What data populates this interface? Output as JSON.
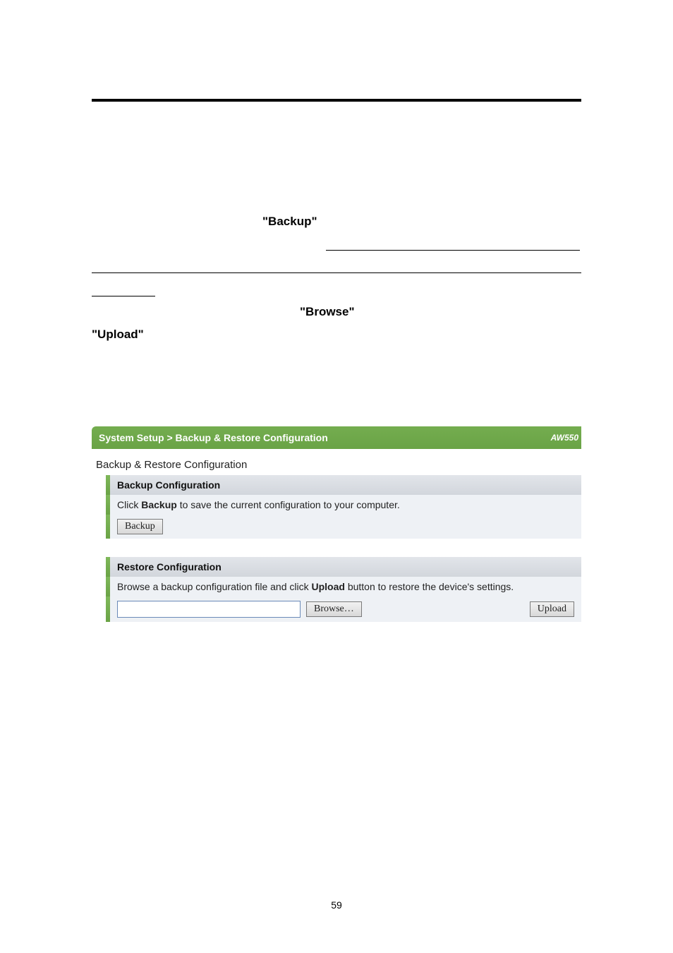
{
  "visible_bold": {
    "backup": "\"Backup\"",
    "browse": "\"Browse\"",
    "upload": "\"Upload\""
  },
  "panel": {
    "breadcrumb": "System Setup > Backup & Restore Configuration",
    "model": "AW550",
    "fieldset_label": "Backup & Restore Configuration",
    "backup_section": {
      "header": "Backup Configuration",
      "desc_pre": "Click ",
      "desc_bold": "Backup",
      "desc_post": " to save the current configuration to your computer.",
      "button": "Backup"
    },
    "restore_section": {
      "header": "Restore Configuration",
      "desc_pre": "Browse a backup configuration file and click ",
      "desc_bold": "Upload",
      "desc_post": " button to restore the device's settings.",
      "browse_button": "Browse…",
      "upload_button": "Upload"
    }
  },
  "page_number": "59"
}
